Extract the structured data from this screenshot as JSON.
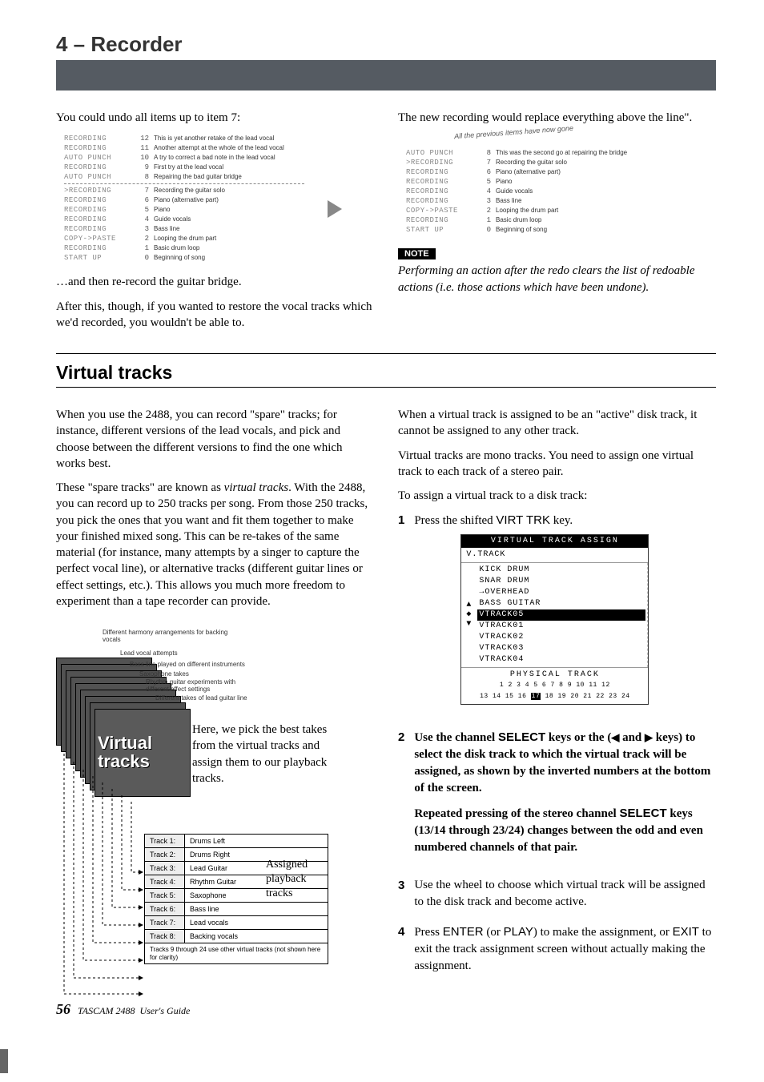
{
  "chapter": {
    "title": "4 – Recorder"
  },
  "undo_intro": "You could undo all items up to item 7:",
  "undo_list_top": [
    {
      "op": "RECORDING",
      "idx": "12",
      "desc": "This is yet another retake of the lead vocal"
    },
    {
      "op": "RECORDING",
      "idx": "11",
      "desc": "Another attempt at the whole of the lead vocal"
    },
    {
      "op": "AUTO PUNCH",
      "idx": "10",
      "desc": "A try to correct a bad note in the lead vocal"
    },
    {
      "op": "RECORDING",
      "idx": "9",
      "desc": "First try at the lead vocal"
    },
    {
      "op": "AUTO PUNCH",
      "idx": "8",
      "desc": "Repairing the bad guitar bridge"
    }
  ],
  "undo_list_bot": [
    {
      "op": ">RECORDING",
      "idx": "7",
      "desc": "Recording the guitar solo"
    },
    {
      "op": "RECORDING",
      "idx": "6",
      "desc": "Piano (alternative part)"
    },
    {
      "op": "RECORDING",
      "idx": "5",
      "desc": "Piano"
    },
    {
      "op": "RECORDING",
      "idx": "4",
      "desc": "Guide vocals"
    },
    {
      "op": "RECORDING",
      "idx": "3",
      "desc": "Bass line"
    },
    {
      "op": "COPY->PASTE",
      "idx": "2",
      "desc": "Looping the drum part"
    },
    {
      "op": "RECORDING",
      "idx": "1",
      "desc": "Basic drum loop"
    },
    {
      "op": "START UP",
      "idx": "0",
      "desc": "Beginning of song"
    }
  ],
  "undo_after_a": "…and then re-record the guitar bridge.",
  "undo_after_b": "After this, though, if you wanted to restore the vocal tracks which we'd recorded, you wouldn't be able to.",
  "redo_intro": "The new recording would replace everything above the line\".",
  "redo_annot": "All the previous items have now gone",
  "redo_list": [
    {
      "op": "AUTO PUNCH",
      "idx": "8",
      "desc": "This was the second go at repairing the bridge"
    },
    {
      "op": ">RECORDING",
      "idx": "7",
      "desc": "Recording the guitar solo"
    },
    {
      "op": "RECORDING",
      "idx": "6",
      "desc": "Piano (alternative part)"
    },
    {
      "op": "RECORDING",
      "idx": "5",
      "desc": "Piano"
    },
    {
      "op": "RECORDING",
      "idx": "4",
      "desc": "Guide vocals"
    },
    {
      "op": "RECORDING",
      "idx": "3",
      "desc": "Bass line"
    },
    {
      "op": "COPY->PASTE",
      "idx": "2",
      "desc": "Looping the drum part"
    },
    {
      "op": "RECORDING",
      "idx": "1",
      "desc": "Basic drum loop"
    },
    {
      "op": "START UP",
      "idx": "0",
      "desc": "Beginning of song"
    }
  ],
  "note_badge": "NOTE",
  "note_text": "Performing an action after the redo clears the list of redoable actions (i.e. those actions which have been undone).",
  "sec_title": "Virtual tracks",
  "vt_p1": "When you use the 2488, you can record \"spare\" tracks; for instance, different versions of the lead vocals, and pick and choose between the different versions to find the one which works best.",
  "vt_p2_a": "These \"spare tracks\" are known as ",
  "vt_p2_i": "virtual tracks",
  "vt_p2_b": ". With the 2488, you can record up to 250 tracks per song. From those 250 tracks, you pick the ones that you want and fit them together to make your finished mixed song. This can be re-takes of the same material (for instance, many attempts by a singer to capture the perfect vocal line), or alternative tracks (different guitar lines or effect settings, etc.). This allows you much more freedom to experiment than a tape recorder can provide.",
  "diagram": {
    "labels": {
      "l0": "Different harmony arrangements for backing vocals",
      "l1": "Lead vocal attempts",
      "l2": "Bass line played on different instruments",
      "l3": "Saxophone takes",
      "l4": "Rhythm guitar experiments with different effect settings",
      "l5": "Different takes of lead guitar line"
    },
    "vt_label_a": "Virtual",
    "vt_label_b": "tracks",
    "caption": "Here, we pick the best takes from the virtual tracks and assign them to our playback tracks.",
    "tracks": [
      {
        "n": "Track 1:",
        "v": "Drums Left"
      },
      {
        "n": "Track 2:",
        "v": "Drums Right"
      },
      {
        "n": "Track 3:",
        "v": "Lead Guitar"
      },
      {
        "n": "Track 4:",
        "v": "Rhythm Guitar"
      },
      {
        "n": "Track 5:",
        "v": "Saxophone"
      },
      {
        "n": "Track 6:",
        "v": "Bass line"
      },
      {
        "n": "Track 7:",
        "v": "Lead vocals"
      },
      {
        "n": "Track 8:",
        "v": "Backing vocals"
      }
    ],
    "tracks_note": "Tracks 9 through 24 use other virtual tracks (not shown here for clarity)",
    "assigned": "Assigned playback tracks"
  },
  "vt_r1": "When a virtual track is assigned to be an \"active\" disk track, it cannot be assigned to any other track.",
  "vt_r2": "Virtual tracks are mono tracks. You need to assign one virtual track to each track of a stereo pair.",
  "vt_r3": "To assign a virtual track to a disk track:",
  "steps": {
    "s1_a": "Press the shifted ",
    "s1_b": "VIRT TRK",
    "s1_c": " key.",
    "s2_a": "Use the channel ",
    "s2_b": "SELECT",
    "s2_c": " keys or the (",
    "s2_d": " and ",
    "s2_e": " keys) to select the disk track to which the virtual track will be assigned, as shown by the inverted numbers at the bottom of the screen.",
    "s2_f": "Repeated pressing of the stereo channel ",
    "s2_g": " keys (13/14 through 23/24) changes between the odd and even numbered channels of that pair.",
    "s3": "Use the wheel to choose which virtual track will be assigned to the disk track and become active.",
    "s4_a": "Press ",
    "s4_b": "ENTER",
    "s4_c": " (or ",
    "s4_d": "PLAY",
    "s4_e": ") to make the assignment, or ",
    "s4_f": "EXIT",
    "s4_g": " to exit the track assignment screen without actually making the assignment."
  },
  "lcd": {
    "title": "VIRTUAL TRACK ASSIGN",
    "sub": "V.TRACK",
    "items": [
      "KICK DRUM",
      "SNAR DRUM",
      "→OVERHEAD",
      "BASS GUITAR",
      "VTRACK05",
      "VTRACK01",
      "VTRACK02",
      "VTRACK03",
      "VTRACK04"
    ],
    "sel_index": 4,
    "phys": "PHYSICAL TRACK",
    "nums_a": "1  2  3  4  5  6  7  8  9 10 11 12",
    "nums_b_pre": "13 14 15 16 ",
    "nums_b_sel": "17",
    "nums_b_post": " 18 19 20 21 22 23 24"
  },
  "footer": {
    "page": "56",
    "product": "TASCAM 2488",
    "guide": "User's Guide"
  }
}
